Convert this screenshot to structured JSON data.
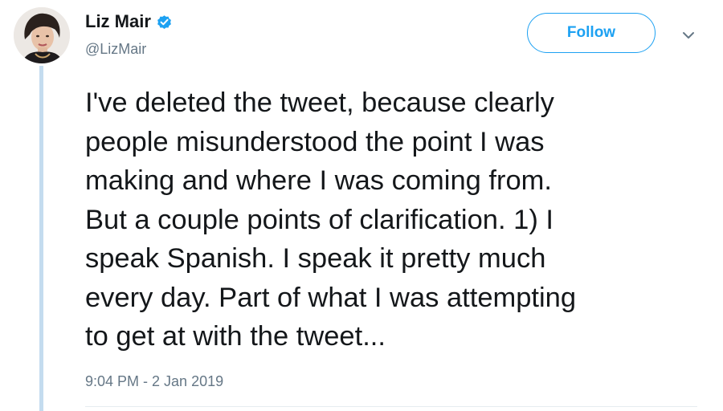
{
  "tweet": {
    "author": {
      "display_name": "Liz Mair",
      "handle": "@LizMair",
      "verified": true,
      "avatar_icon": "user-avatar"
    },
    "follow_label": "Follow",
    "menu_icon": "chevron-down-icon",
    "text": "I've deleted the tweet, because clearly\npeople misunderstood the point I was\nmaking and where I was coming from.\nBut a couple points of clarification. 1) I\nspeak Spanish. I speak it pretty much\nevery day. Part of what I was attempting\nto get at with the tweet...",
    "timestamp": "9:04 PM - 2 Jan 2019"
  },
  "colors": {
    "accent": "#1da1f2",
    "secondary_text": "#657786",
    "primary_text": "#14171a",
    "thread_line": "#c4dcef"
  }
}
